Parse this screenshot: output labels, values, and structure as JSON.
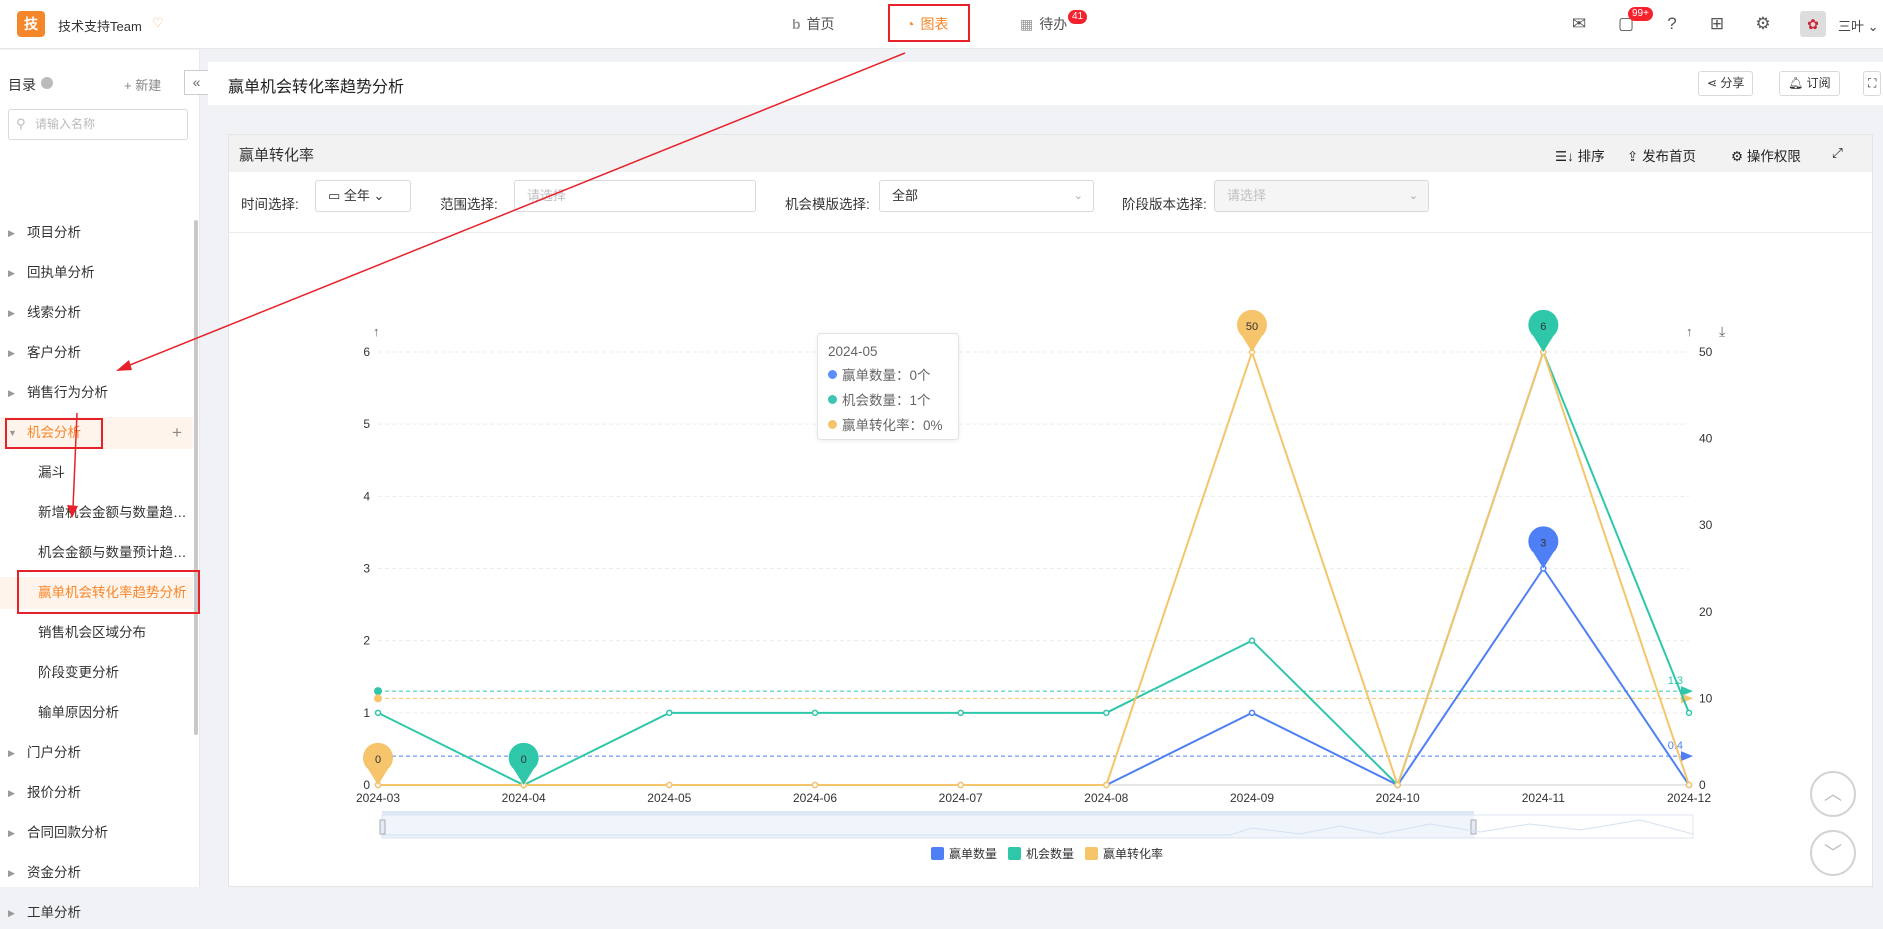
{
  "topbar": {
    "logo_char": "技",
    "team_name": "技术支持Team",
    "tabs": [
      {
        "label": "首页",
        "icon": "b-home-icon"
      },
      {
        "label": "图表",
        "icon": "pie-chart-icon",
        "active": true
      },
      {
        "label": "待办",
        "icon": "calendar-icon",
        "badge": "41"
      }
    ],
    "msg_badge": "99+",
    "user_name": "三叶"
  },
  "sidebar": {
    "title": "目录",
    "new_label": "+ 新建",
    "search_placeholder": "请输入名称",
    "items": [
      {
        "label": "项目分析"
      },
      {
        "label": "回执单分析"
      },
      {
        "label": "线索分析"
      },
      {
        "label": "客户分析"
      },
      {
        "label": "销售行为分析"
      },
      {
        "label": "机会分析",
        "open": true
      },
      {
        "label": "漏斗",
        "child": true
      },
      {
        "label": "新增机会金额与数量趋…",
        "child": true
      },
      {
        "label": "机会金额与数量预计趋…",
        "child": true
      },
      {
        "label": "赢单机会转化率趋势分析",
        "child": true,
        "active": true
      },
      {
        "label": "销售机会区域分布",
        "child": true
      },
      {
        "label": "阶段变更分析",
        "child": true
      },
      {
        "label": "输单原因分析",
        "child": true
      },
      {
        "label": "门户分析"
      },
      {
        "label": "报价分析"
      },
      {
        "label": "合同回款分析"
      },
      {
        "label": "资金分析"
      },
      {
        "label": "工单分析"
      }
    ]
  },
  "main": {
    "title": "赢单机会转化率趋势分析",
    "share_label": "分享",
    "subscribe_label": "订阅"
  },
  "card": {
    "title": "赢单转化率",
    "actions": {
      "sort": "排序",
      "publish": "发布首页",
      "perm": "操作权限"
    },
    "filters": {
      "time_label": "时间选择:",
      "time_value": "全年",
      "range_label": "范围选择:",
      "range_placeholder": "请选择",
      "template_label": "机会模版选择:",
      "template_value": "全部",
      "stage_label": "阶段版本选择:",
      "stage_placeholder": "请选择"
    }
  },
  "tooltip": {
    "title": "2024-05",
    "rows": [
      {
        "text": "赢单数量：0个",
        "color": "#5b8ff9"
      },
      {
        "text": "机会数量：1个",
        "color": "#3cc4b4"
      },
      {
        "text": "赢单转化率：0%",
        "color": "#f6c46b"
      }
    ]
  },
  "chart_data": {
    "type": "line",
    "categories": [
      "2024-03",
      "2024-04",
      "2024-05",
      "2024-06",
      "2024-07",
      "2024-08",
      "2024-09",
      "2024-10",
      "2024-11",
      "2024-12"
    ],
    "left_axis": {
      "ticks": [
        "0",
        "1",
        "2",
        "3",
        "4",
        "5",
        "6"
      ],
      "ylim": [
        0,
        6
      ]
    },
    "right_axis": {
      "ticks": [
        "0",
        "10",
        "20",
        "30",
        "40",
        "50"
      ],
      "ylim": [
        0,
        50
      ]
    },
    "series": [
      {
        "name": "赢单数量",
        "axis": "left",
        "color": "#4e7ff5",
        "values": [
          0,
          0,
          0,
          0,
          0,
          0,
          1,
          0,
          3,
          0
        ],
        "average": 0.4,
        "average_label": "0.4"
      },
      {
        "name": "机会数量",
        "axis": "left",
        "color": "#2ec7aa",
        "values": [
          1,
          0,
          1,
          1,
          1,
          1,
          2,
          0,
          6,
          1
        ],
        "average": 1.3,
        "average_label": "1.3"
      },
      {
        "name": "赢单转化率",
        "axis": "right",
        "color": "#f6c46b",
        "values": [
          0,
          0,
          0,
          0,
          0,
          0,
          50,
          0,
          50,
          0
        ],
        "average": 10
      }
    ],
    "markers": [
      {
        "series": 2,
        "index": 0,
        "label": "0"
      },
      {
        "series": 1,
        "index": 1,
        "label": "0"
      },
      {
        "series": 2,
        "index": 6,
        "label": "50"
      },
      {
        "series": 1,
        "index": 8,
        "label": "6"
      },
      {
        "series": 0,
        "index": 8,
        "label": "3"
      }
    ],
    "legend": [
      "赢单数量",
      "机会数量",
      "赢单转化率"
    ],
    "grid": true
  }
}
